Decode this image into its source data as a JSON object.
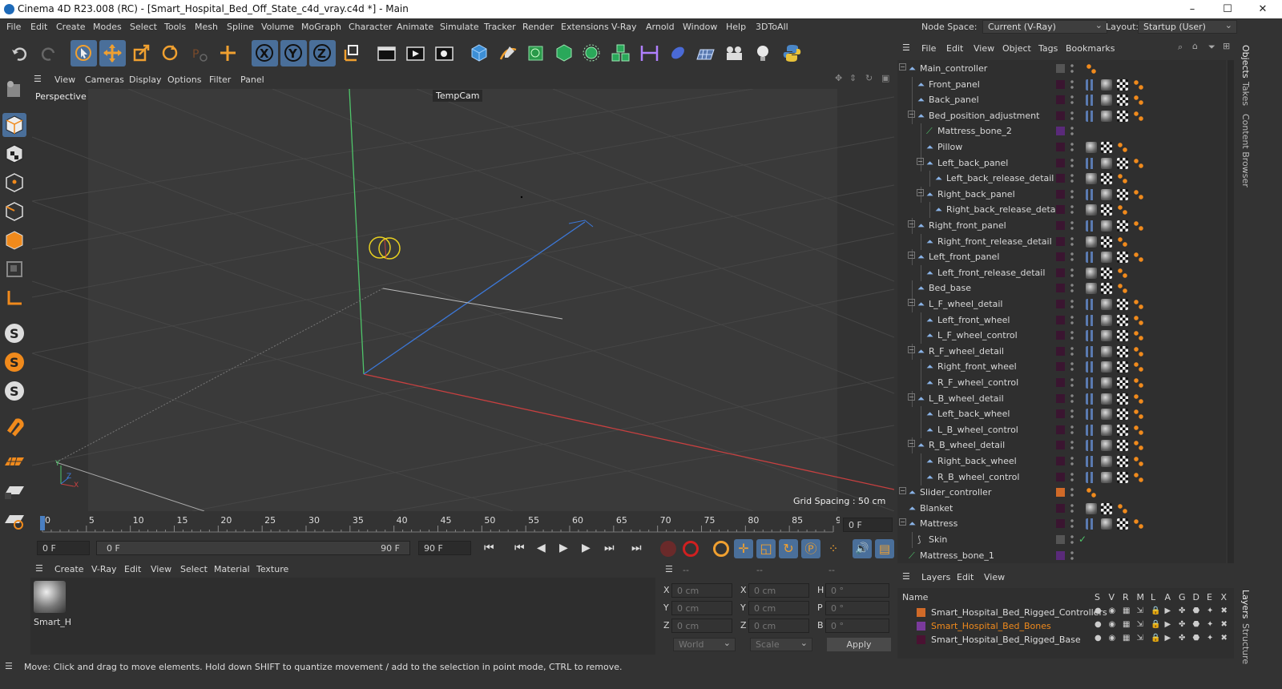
{
  "window": {
    "title": "Cinema 4D R23.008 (RC) - [Smart_Hospital_Bed_Off_State_c4d_vray.c4d *] - Main",
    "minimize": "–",
    "maximize": "☐",
    "close": "✕"
  },
  "menu": [
    "File",
    "Edit",
    "Create",
    "Modes",
    "Select",
    "Tools",
    "Mesh",
    "Spline",
    "Volume",
    "MoGraph",
    "Character",
    "Animate",
    "Simulate",
    "Tracker",
    "Render",
    "Extensions",
    "V-Ray",
    "Arnold",
    "Window",
    "Help",
    "3DToAll"
  ],
  "nodespace": {
    "label": "Node Space:",
    "value": "Current (V-Ray)",
    "layout_label": "Layout:",
    "layout_value": "Startup (User)"
  },
  "viewport": {
    "menu": [
      "View",
      "Cameras",
      "Display",
      "Options",
      "Filter",
      "Panel"
    ],
    "label": "Perspective",
    "camera": "TempCam",
    "grid": "Grid Spacing : 50 cm",
    "axis_y": "Y",
    "axis_z": "Z",
    "axis_x": "X"
  },
  "timeline": {
    "ticks": [
      "0",
      "5",
      "10",
      "15",
      "20",
      "25",
      "30",
      "35",
      "40",
      "45",
      "50",
      "55",
      "60",
      "65",
      "70",
      "75",
      "80",
      "85",
      "90"
    ],
    "frame": "0 F"
  },
  "transport": {
    "start": "0 F",
    "range_start": "0 F",
    "range_end": "90 F",
    "end": "90 F"
  },
  "material": {
    "menu": [
      "Create",
      "V-Ray",
      "Edit",
      "View",
      "Select",
      "Material",
      "Texture"
    ],
    "name": "Smart_H"
  },
  "coords": {
    "headers": [
      "--",
      "--",
      "--"
    ],
    "rows": [
      [
        "X",
        "0 cm",
        "X",
        "0 cm",
        "H",
        "0 °"
      ],
      [
        "Y",
        "0 cm",
        "Y",
        "0 cm",
        "P",
        "0 °"
      ],
      [
        "Z",
        "0 cm",
        "Z",
        "0 cm",
        "B",
        "0 °"
      ]
    ],
    "mode": "World",
    "scale": "Scale",
    "apply": "Apply"
  },
  "status": "Move: Click and drag to move elements. Hold down SHIFT to quantize movement / add to the selection in point mode, CTRL to remove.",
  "objects_menu": [
    "File",
    "Edit",
    "View",
    "Object",
    "Tags",
    "Bookmarks"
  ],
  "objects": [
    {
      "name": "Main_controller",
      "depth": 0,
      "exp": true,
      "type": "null",
      "tags": "ctrl"
    },
    {
      "name": "Front_panel",
      "depth": 1,
      "exp": false,
      "type": "joint",
      "tags": "full"
    },
    {
      "name": "Back_panel",
      "depth": 1,
      "exp": false,
      "type": "joint",
      "tags": "full"
    },
    {
      "name": "Bed_position_adjustment",
      "depth": 1,
      "exp": true,
      "type": "joint",
      "tags": "full"
    },
    {
      "name": "Mattress_bone_2",
      "depth": 2,
      "exp": false,
      "type": "bone",
      "tags": "none"
    },
    {
      "name": "Pillow",
      "depth": 2,
      "exp": false,
      "type": "joint",
      "tags": "short"
    },
    {
      "name": "Left_back_panel",
      "depth": 2,
      "exp": true,
      "type": "joint",
      "tags": "full"
    },
    {
      "name": "Left_back_release_detail",
      "depth": 3,
      "exp": false,
      "type": "joint",
      "tags": "short"
    },
    {
      "name": "Right_back_panel",
      "depth": 2,
      "exp": true,
      "type": "joint",
      "tags": "full"
    },
    {
      "name": "Right_back_release_detail",
      "depth": 3,
      "exp": false,
      "type": "joint",
      "tags": "short"
    },
    {
      "name": "Right_front_panel",
      "depth": 1,
      "exp": true,
      "type": "joint",
      "tags": "full"
    },
    {
      "name": "Right_front_release_detail",
      "depth": 2,
      "exp": false,
      "type": "joint",
      "tags": "short"
    },
    {
      "name": "Left_front_panel",
      "depth": 1,
      "exp": true,
      "type": "joint",
      "tags": "full"
    },
    {
      "name": "Left_front_release_detail",
      "depth": 2,
      "exp": false,
      "type": "joint",
      "tags": "short"
    },
    {
      "name": "Bed_base",
      "depth": 1,
      "exp": false,
      "type": "joint",
      "tags": "short"
    },
    {
      "name": "L_F_wheel_detail",
      "depth": 1,
      "exp": true,
      "type": "joint",
      "tags": "full"
    },
    {
      "name": "Left_front_wheel",
      "depth": 2,
      "exp": false,
      "type": "joint",
      "tags": "full"
    },
    {
      "name": "L_F_wheel_control",
      "depth": 2,
      "exp": false,
      "type": "joint",
      "tags": "full"
    },
    {
      "name": "R_F_wheel_detail",
      "depth": 1,
      "exp": true,
      "type": "joint",
      "tags": "full"
    },
    {
      "name": "Right_front_wheel",
      "depth": 2,
      "exp": false,
      "type": "joint",
      "tags": "full"
    },
    {
      "name": "R_F_wheel_control",
      "depth": 2,
      "exp": false,
      "type": "joint",
      "tags": "full"
    },
    {
      "name": "L_B_wheel_detail",
      "depth": 1,
      "exp": true,
      "type": "joint",
      "tags": "full"
    },
    {
      "name": "Left_back_wheel",
      "depth": 2,
      "exp": false,
      "type": "joint",
      "tags": "full"
    },
    {
      "name": "L_B_wheel_control",
      "depth": 2,
      "exp": false,
      "type": "joint",
      "tags": "full"
    },
    {
      "name": "R_B_wheel_detail",
      "depth": 1,
      "exp": true,
      "type": "joint",
      "tags": "full"
    },
    {
      "name": "Right_back_wheel",
      "depth": 2,
      "exp": false,
      "type": "joint",
      "tags": "full"
    },
    {
      "name": "R_B_wheel_control",
      "depth": 2,
      "exp": false,
      "type": "joint",
      "tags": "full"
    },
    {
      "name": "Slider_controller",
      "depth": 0,
      "exp": true,
      "type": "joint",
      "tags": "ctrl2"
    },
    {
      "name": "Blanket",
      "depth": 0,
      "exp": false,
      "type": "joint",
      "tags": "short"
    },
    {
      "name": "Mattress",
      "depth": 0,
      "exp": true,
      "type": "joint",
      "tags": "full"
    },
    {
      "name": "Skin",
      "depth": 1,
      "exp": false,
      "type": "skin",
      "tags": "skin"
    },
    {
      "name": "Mattress_bone_1",
      "depth": 0,
      "exp": false,
      "type": "bone",
      "tags": "none"
    }
  ],
  "layers_menu": [
    "Layers",
    "Edit",
    "View"
  ],
  "layers_header": {
    "name": "Name",
    "cols": [
      "S",
      "V",
      "R",
      "M",
      "L",
      "A",
      "G",
      "D",
      "E",
      "X"
    ]
  },
  "layers": [
    {
      "name": "Smart_Hospital_Bed_Rigged_Controllers",
      "color": "#d06a28",
      "sel": false
    },
    {
      "name": "Smart_Hospital_Bed_Bones",
      "color": "#7a3a9c",
      "sel": true
    },
    {
      "name": "Smart_Hospital_Bed_Rigged_Base",
      "color": "#4a1232",
      "sel": false
    }
  ],
  "side_tabs": [
    "Objects",
    "Takes",
    "Content Browser",
    "Layers",
    "Structure"
  ],
  "colors": {
    "accent": "#4a6f9a",
    "orange": "#f08a1c",
    "selected_layer_text": "#f08a1c"
  }
}
